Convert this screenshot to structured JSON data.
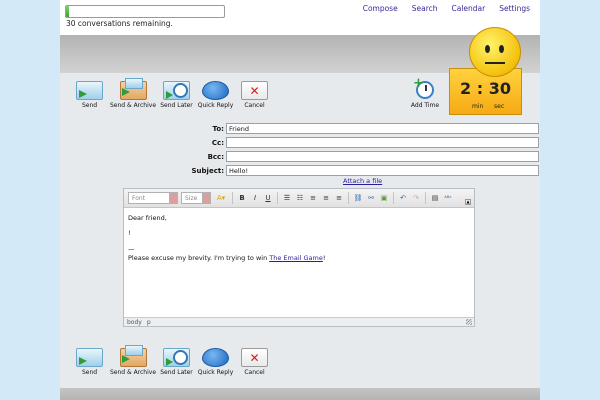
{
  "topbar": {
    "progress": 0.02,
    "remaining": "30 conversations remaining.",
    "nav": [
      {
        "label": "Compose"
      },
      {
        "label": "Search"
      },
      {
        "label": "Calendar"
      },
      {
        "label": "Settings"
      }
    ]
  },
  "toolbar": {
    "send": "Send",
    "send_archive": "Send & Archive",
    "send_later": "Send Later",
    "quick_reply": "Quick Reply",
    "cancel": "Cancel"
  },
  "add_time": "Add Time",
  "timer": {
    "value": "2 : 30",
    "min_label": "min",
    "sec_label": "sec"
  },
  "form": {
    "to_label": "To:",
    "to_value": "Friend",
    "cc_label": "Cc:",
    "cc_value": "",
    "bcc_label": "Bcc:",
    "bcc_value": "",
    "subject_label": "Subject:",
    "subject_value": "Hello!",
    "attach": "Attach a file"
  },
  "editor": {
    "font_placeholder": "Font",
    "size_placeholder": "Size",
    "body": {
      "greeting": "Dear friend,",
      "line2": "!",
      "sig_sep": "—",
      "sig_text": "Please excuse my brevity. I'm trying to win ",
      "sig_link": "The Email Game",
      "sig_end": "!"
    },
    "status": [
      "body",
      "p"
    ]
  },
  "colors": {
    "timer": "#f6aa14",
    "nav_link": "#3a2a99",
    "background": "#d4e9f7"
  }
}
